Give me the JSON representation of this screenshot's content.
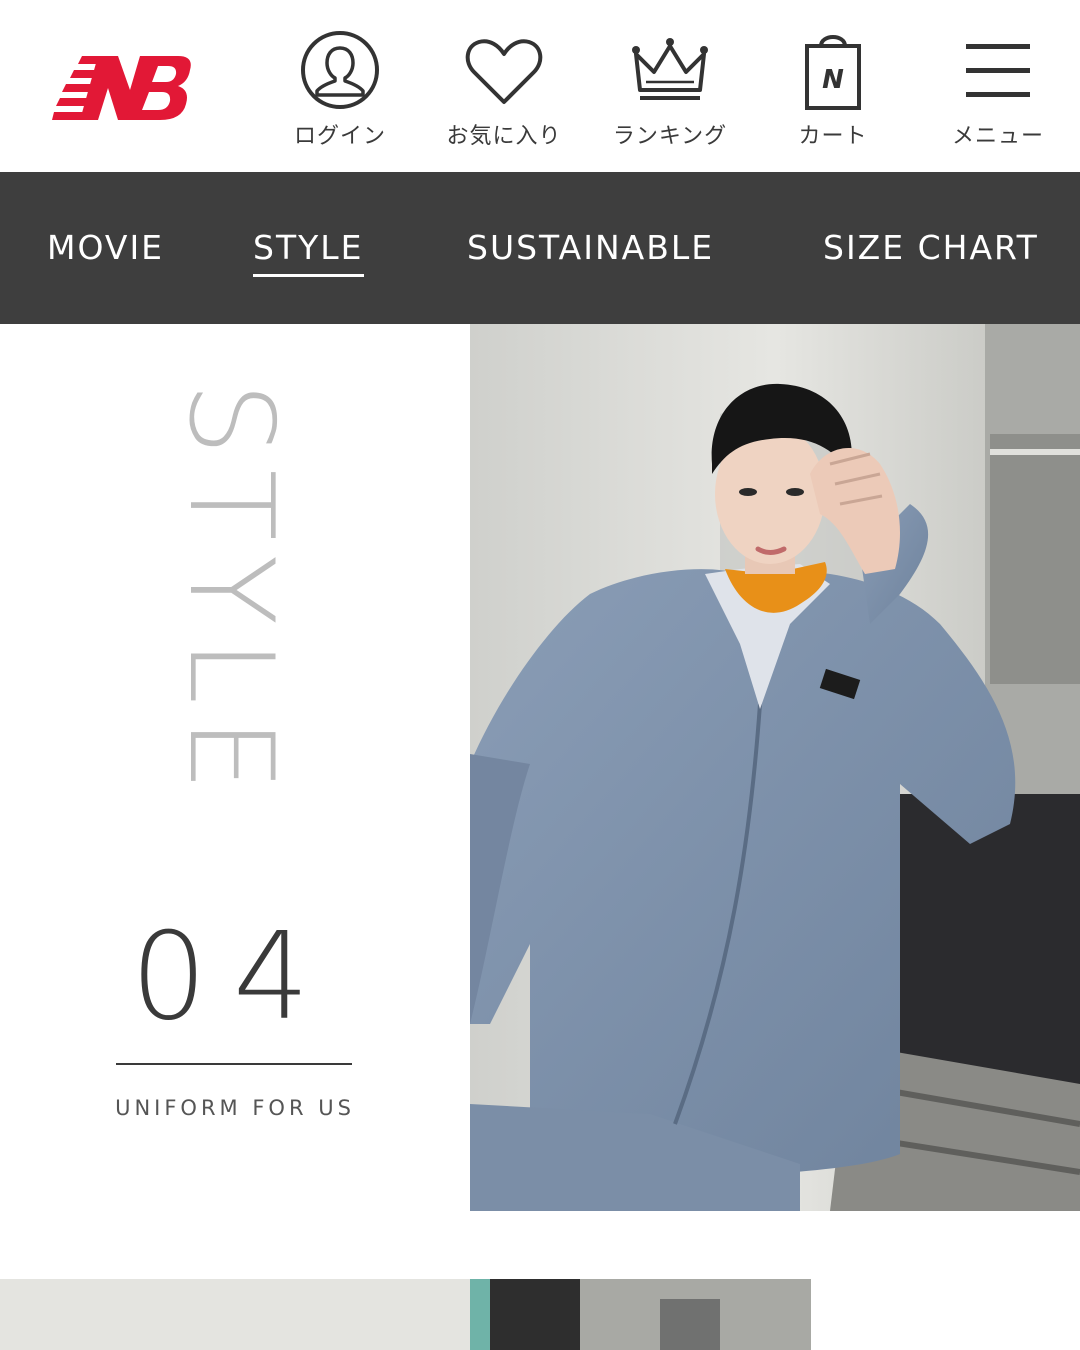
{
  "header": {
    "logo_label": "NB",
    "nav": [
      {
        "icon": "login-user-icon",
        "label": "ログイン"
      },
      {
        "icon": "heart-icon",
        "label": "お気に入り"
      },
      {
        "icon": "crown-icon",
        "label": "ランキング"
      },
      {
        "icon": "shopping-bag-icon",
        "label": "カート"
      },
      {
        "icon": "hamburger-menu-icon",
        "label": "メニュー"
      }
    ]
  },
  "tabs": [
    {
      "label": "MOVIE",
      "active": false
    },
    {
      "label": "STYLE",
      "active": true
    },
    {
      "label": "SUSTAINABLE",
      "active": false
    },
    {
      "label": "SIZE CHART",
      "active": false
    }
  ],
  "style_section": {
    "vertical_title": "STYLE",
    "number": "04",
    "subtitle": "UNIFORM FOR US"
  },
  "colors": {
    "brand_red": "#e21836",
    "tabbar_bg": "#3e3e3e",
    "jacket_blue": "#7f93ad",
    "turtleneck_orange": "#e89018"
  }
}
